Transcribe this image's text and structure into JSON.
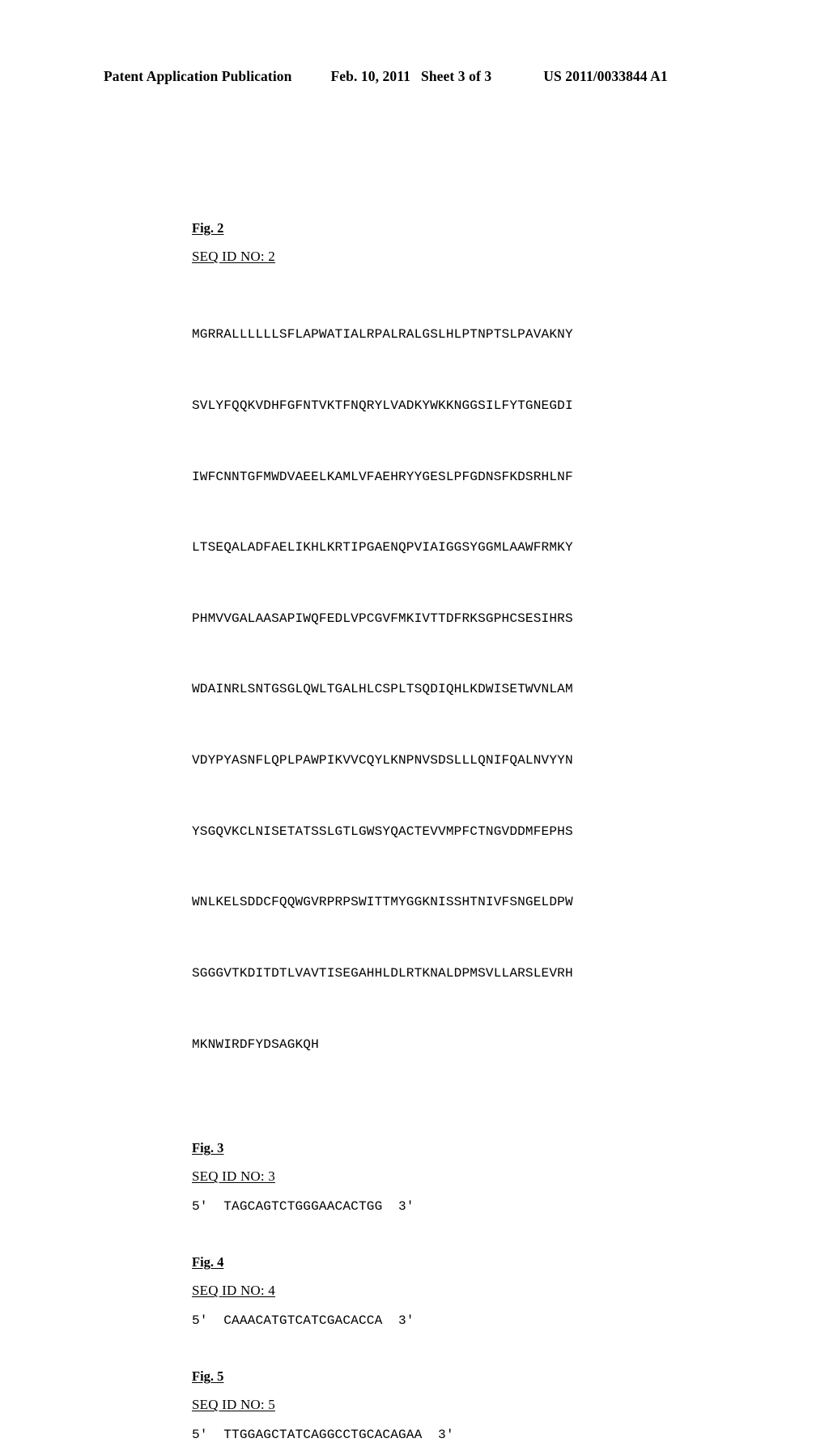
{
  "header": {
    "publication": "Patent Application Publication",
    "date": "Feb. 10, 2011",
    "sheet": "Sheet 3 of 3",
    "patent_number": "US 2011/0033844 A1"
  },
  "figures": [
    {
      "fig_label": "Fig. 2",
      "seq_id": "SEQ ID NO: 2",
      "type": "protein",
      "lines": [
        "MGRRALLLLLLSFLAPWATIALRPALRALGSLHLPTNPTSLPAVAKNY",
        "SVLYFQQKVDHFGFNTVKTFNQRYLVADKYWKKNGGSILFYTGNEGDI",
        "IWFCNNTGFMWDVAEELKAMLVFAEHRYYGESLPFGDNSFKDSRHLNF",
        "LTSEQALADFAELIKHLKRTIPGAENQPVIAIGGSYGGMLAAWFRMKY",
        "PHMVVGALAASAPIWQFEDLVPCGVFMKIVTTDFRKSGPHCSESIHRS",
        "WDAINRLSNTGSGLQWLTGALHLCSPLTSQDIQHLKDWISETWVNLAM",
        "VDYPYASNFLQPLPAWPIKVVCQYLKNPNVSDSLLLQNIFQALNVYYN",
        "YSGQVKCLNISETATSSLGTLGWSYQACTEVVMPFCTNGVDDMFEPHS",
        "WNLKELSDDCFQQWGVRPRPSWITTMYGGKNISSHTNIVFSNGELDPW",
        "SGGGVTKDITDTLVAVTISEGAHHLDLRTKNALDPMSVLLARSLEVRH",
        "MKNWIRDFYDSAGKQH"
      ]
    },
    {
      "fig_label": "Fig. 3",
      "seq_id": "SEQ ID NO: 3",
      "type": "nucleotide",
      "sequence_line": "5'  TAGCAGTCTGGGAACACTGG  3'"
    },
    {
      "fig_label": "Fig. 4",
      "seq_id": "SEQ ID NO: 4",
      "type": "nucleotide",
      "sequence_line": "5'  CAAACATGTCATCGACACCA  3'"
    },
    {
      "fig_label": "Fig. 5",
      "seq_id": "SEQ ID NO: 5",
      "type": "nucleotide",
      "sequence_line": "5'  TTGGAGCTATCAGGCCTGCACAGAA  3'"
    }
  ]
}
